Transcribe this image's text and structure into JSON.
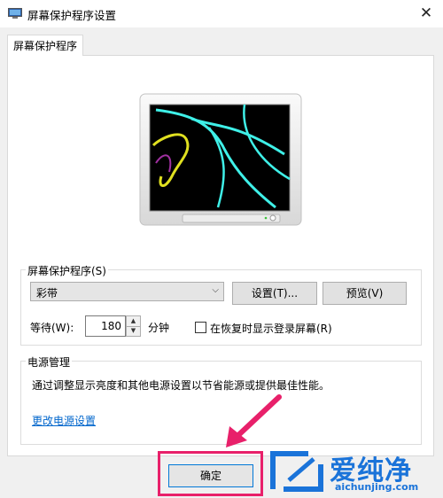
{
  "window": {
    "title": "屏幕保护程序设置",
    "close_label": "✕"
  },
  "tab": {
    "label": "屏幕保护程序"
  },
  "screensaver": {
    "group_label": "屏幕保护程序(S)",
    "selected": "彩带",
    "settings_button": "设置(T)...",
    "preview_button": "预览(V)",
    "wait_label": "等待(W):",
    "wait_value": "180",
    "minutes_label": "分钟",
    "resume_checkbox_label": "在恢复时显示登录屏幕(R)",
    "resume_checked": false
  },
  "power": {
    "group_label": "电源管理",
    "description": "通过调整显示亮度和其他电源设置以节省能源或提供最佳性能。",
    "link": "更改电源设置"
  },
  "footer": {
    "ok_button": "确定"
  },
  "watermark": {
    "brand": "爱纯净",
    "url": "aichunjing.com"
  },
  "colors": {
    "highlight": "#e8206a",
    "link": "#0066cc",
    "accent": "#0078d7"
  }
}
